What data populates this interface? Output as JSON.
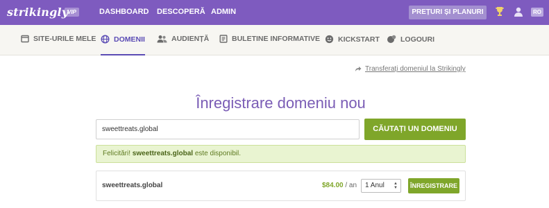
{
  "app": {
    "logo": "strikingly",
    "badge": "VIP"
  },
  "topnav": {
    "items": [
      "DASHBOARD",
      "DESCOPERĂ",
      "ADMIN"
    ],
    "pricing_label": "PREȚURI ȘI PLANURI",
    "language": "RO"
  },
  "subnav": {
    "items": [
      {
        "label": "SITE-URILE MELE",
        "icon": "window-icon"
      },
      {
        "label": "DOMENII",
        "icon": "globe-icon"
      },
      {
        "label": "AUDIENȚĂ",
        "icon": "users-icon"
      },
      {
        "label": "BULETINE INFORMATIVE",
        "icon": "newsletter-icon"
      },
      {
        "label": "KICKSTART",
        "icon": "smile-icon"
      },
      {
        "label": "LOGOURI",
        "icon": "logo-icon"
      }
    ],
    "active": "DOMENII"
  },
  "transfer_link": "Transferați domeniul la Strikingly",
  "page_title": "Înregistrare domeniu nou",
  "search": {
    "value": "sweettreats.global",
    "button_label": "CĂUTAȚI UN DOMENIU"
  },
  "availability": {
    "prefix": "Felicitări!",
    "domain": "sweettreats.global",
    "suffix": "este disponibil."
  },
  "result": {
    "domain": "sweettreats.global",
    "price": "$84.00",
    "per": "/ an",
    "period_selected": "1 Anul",
    "register_label": "ÎNREGISTRARE"
  },
  "colors": {
    "topbar": "#7e5bbf",
    "accent": "#5a4bb4",
    "green": "#7fa62a",
    "success_bg": "#e9f4d1"
  }
}
